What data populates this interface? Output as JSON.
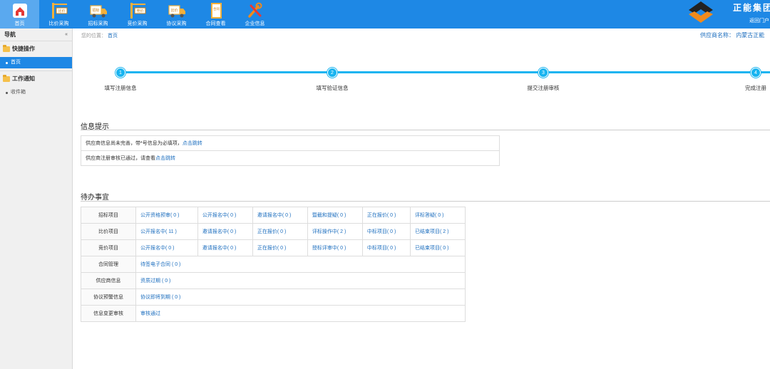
{
  "topnav": {
    "items": [
      {
        "label": "首页",
        "icon": "home-icon"
      },
      {
        "label": "比价采购",
        "icon": "price-compare-icon",
        "sign": "比价"
      },
      {
        "label": "招标采购",
        "icon": "tender-truck-icon",
        "sign": "招标"
      },
      {
        "label": "竞价采购",
        "icon": "bidding-crane-icon",
        "sign": "竞价"
      },
      {
        "label": "协议采购",
        "icon": "agreement-truck-icon",
        "sign": "比价"
      },
      {
        "label": "合同查看",
        "icon": "contract-icon",
        "sign": "合同"
      },
      {
        "label": "企业信息",
        "icon": "tools-icon"
      }
    ]
  },
  "brand": {
    "name": "正能集团",
    "portal_link": "返回门户"
  },
  "sidebar": {
    "nav_title": "导航",
    "collapse_symbol": "«",
    "groups": [
      {
        "title": "快捷操作",
        "items": [
          {
            "label": "首页",
            "active": true
          }
        ]
      },
      {
        "title": "工作通知",
        "items": [
          {
            "label": "收件箱",
            "active": false
          }
        ]
      }
    ]
  },
  "breadcrumb": {
    "prefix": "您的位置：",
    "current": "首页"
  },
  "supplier": {
    "label": "供应商名称：",
    "value": "内蒙古正能"
  },
  "steps": [
    {
      "number": "1",
      "label": "填写注册信息"
    },
    {
      "number": "2",
      "label": "填写验证信息"
    },
    {
      "number": "3",
      "label": "提交注册审核"
    },
    {
      "number": "4",
      "label": "完成注册"
    }
  ],
  "info": {
    "title": "信息提示",
    "rows": [
      {
        "text": "供应商信息尚未完善，带*号信息为必填项，",
        "link": "点击跳转"
      },
      {
        "text": "供应商注册审核已通过，请查看",
        "link": "点击跳转"
      }
    ]
  },
  "todo": {
    "title": "待办事宜",
    "rows": [
      {
        "head": "招标项目",
        "cells": [
          "公开资格预审( 0 )",
          "公开报名中( 0 )",
          "邀请报名中( 0 )",
          "暨截和提疑( 0 )",
          "正在报价( 0 )",
          "评标答疑( 0 )"
        ]
      },
      {
        "head": "比价项目",
        "cells": [
          "公开报名中( 11 )",
          "邀请报名中( 0 )",
          "正在报价( 0 )",
          "评标操作中( 2 )",
          "中标项目( 0 )",
          "已结束项目( 2 )"
        ]
      },
      {
        "head": "竞价项目",
        "cells": [
          "公开报名中( 0 )",
          "邀请报名中( 0 )",
          "正在报价( 0 )",
          "授标评审中( 0 )",
          "中标项目( 0 )",
          "已结束项目( 0 )"
        ]
      },
      {
        "head": "合同管理",
        "cells": [
          "待签电子合同 ( 0 )"
        ]
      },
      {
        "head": "供应商信息",
        "cells": [
          "资质过期 ( 0 )"
        ]
      },
      {
        "head": "协议预警信息",
        "cells": [
          "协议即将到期 ( 0 )"
        ]
      },
      {
        "head": "信息变更审核",
        "cells": [
          "审核通过"
        ]
      }
    ]
  },
  "colors": {
    "topbar": "#1e88e5",
    "step": "#18b4f0",
    "link": "#1e6fbf",
    "brand_orange": "#f08a1c"
  }
}
